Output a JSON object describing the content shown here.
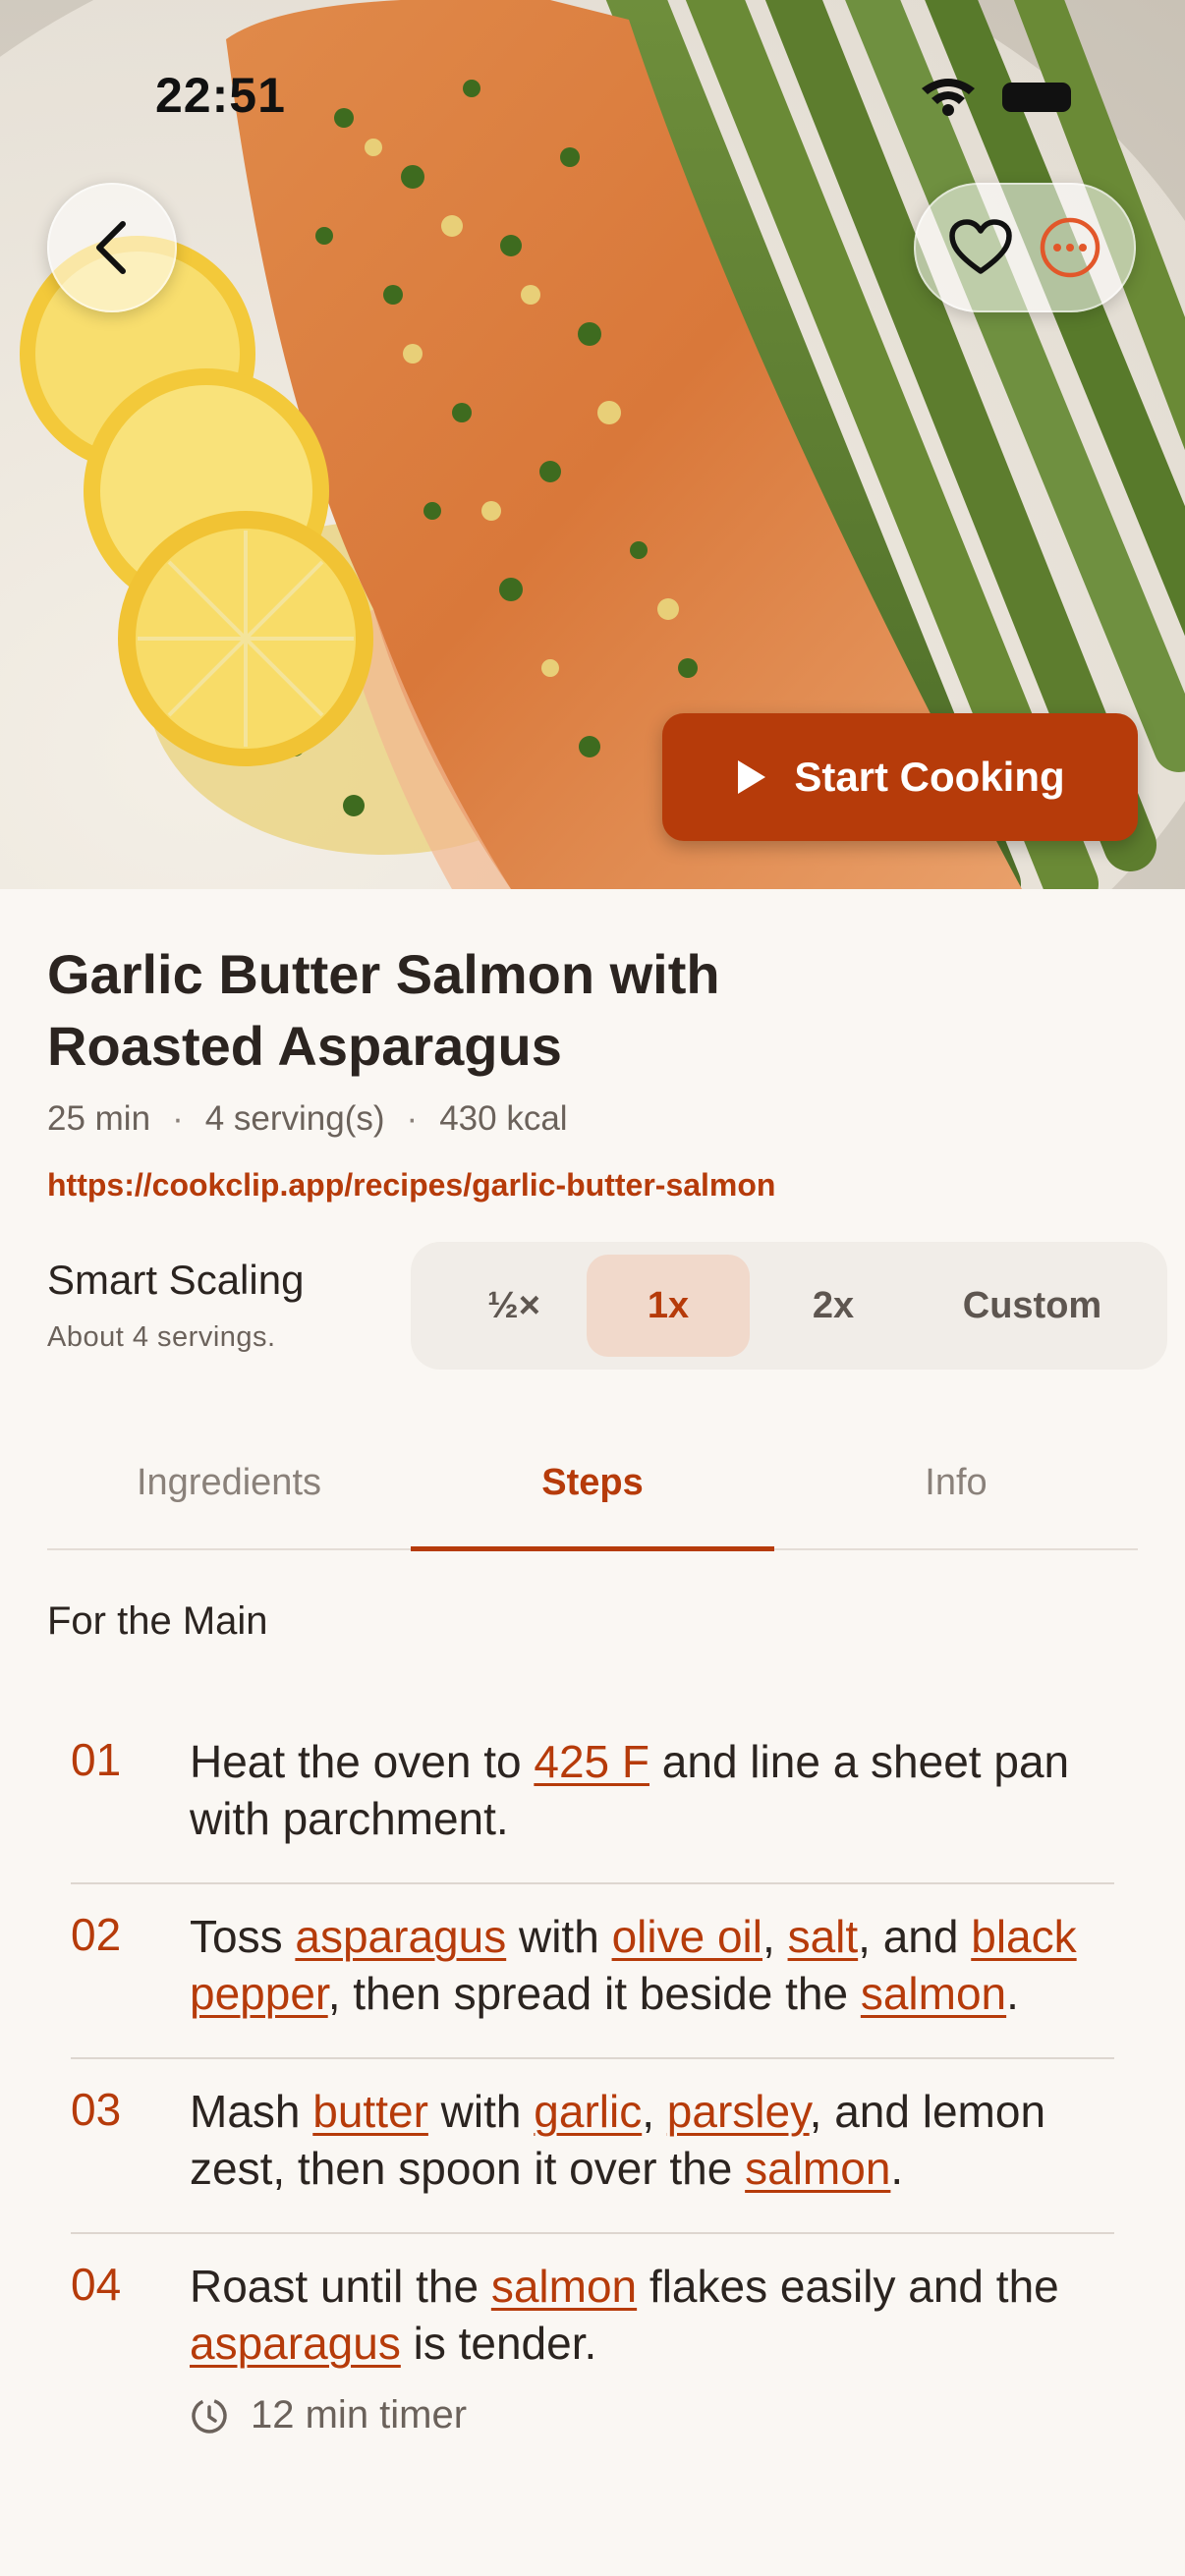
{
  "status_bar": {
    "time": "22:51"
  },
  "hero": {
    "back_icon": "chevron-left-icon",
    "favorite_icon": "heart-icon",
    "more_icon": "ellipsis-circle-icon",
    "start_button": "Start Cooking"
  },
  "recipe": {
    "title_line1": "Garlic Butter Salmon with",
    "title_line2": "Roasted Asparagus",
    "time": "25 min",
    "servings": "4 serving(s)",
    "calories": "430 kcal",
    "dot": "·",
    "url": "https://cookclip.app/recipes/garlic-butter-salmon"
  },
  "scaling": {
    "title": "Smart Scaling",
    "subtitle": "About 4 servings.",
    "options": [
      "½×",
      "1x",
      "2x",
      "Custom"
    ],
    "selected": "1x"
  },
  "tabs": [
    "Ingredients",
    "Steps",
    "Info"
  ],
  "active_tab": "Steps",
  "section": "For the Main",
  "steps": [
    {
      "num": "01",
      "parts": [
        [
          "Heat the oven to ",
          false
        ],
        [
          "425 F",
          true
        ],
        [
          " and line a sheet pan with parchment.",
          false
        ]
      ]
    },
    {
      "num": "02",
      "parts": [
        [
          "Toss ",
          false
        ],
        [
          "asparagus",
          true
        ],
        [
          " with ",
          false
        ],
        [
          "olive oil",
          true
        ],
        [
          ", ",
          false
        ],
        [
          "salt",
          true
        ],
        [
          ", and ",
          false
        ],
        [
          "black pepper",
          true
        ],
        [
          ", then spread it beside the ",
          false
        ],
        [
          "salmon",
          true
        ],
        [
          ".",
          false
        ]
      ]
    },
    {
      "num": "03",
      "parts": [
        [
          "Mash ",
          false
        ],
        [
          "butter",
          true
        ],
        [
          " with ",
          false
        ],
        [
          "garlic",
          true
        ],
        [
          ", ",
          false
        ],
        [
          "parsley",
          true
        ],
        [
          ", and lemon zest, then spoon it over the ",
          false
        ],
        [
          "salmon",
          true
        ],
        [
          ".",
          false
        ]
      ]
    },
    {
      "num": "04",
      "parts": [
        [
          "Roast until the ",
          false
        ],
        [
          "salmon",
          true
        ],
        [
          " flakes easily and the ",
          false
        ],
        [
          "asparagus",
          true
        ],
        [
          " is tender.",
          false
        ]
      ],
      "timer": "12 min timer"
    }
  ],
  "colors": {
    "accent": "#b63b0a",
    "accent_soft": "#f1d9cb",
    "background": "#faf7f3"
  }
}
